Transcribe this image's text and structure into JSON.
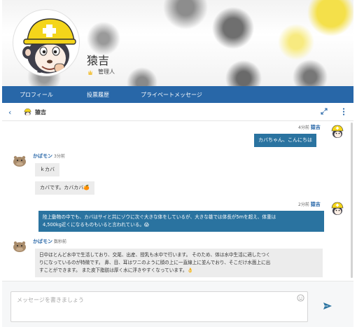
{
  "profile": {
    "name": "猿吉",
    "role": "管理人"
  },
  "nav": {
    "profile": "プロフィール",
    "votes": "投票履歴",
    "private_message": "プライベートメッセージ"
  },
  "chat_header": {
    "back": "‹",
    "title": "猿吉"
  },
  "messages": [
    {
      "time": "4分前",
      "author": "猿吉",
      "text": "カバちゃん、こんにちは"
    },
    {
      "author": "かばモン",
      "time": "3分前",
      "bubbles": [
        "ｋカバ",
        "カバです。カバカバ🍊"
      ]
    },
    {
      "time": "2分前",
      "author": "猿吉",
      "text_line1": "陸上動物の中でも、カバはサイと共にゾウに次ぐ大きな体をしているが、大きな雄では体長が5mを超え、体重は",
      "text_line2": "4,500kg近くになるものもいると言われている。😱"
    },
    {
      "author": "かばモン",
      "time": "数秒前",
      "line1": "日中ほとんど水中で生活しており、交尾、出産、授乳も水中で行います。 そのため、体は水中生活に適したつく",
      "line2": "りになっているのが特徴です。 鼻、目、耳はワニのように顔の上に一直線上に並んでおり、そこだけ水面上に出",
      "line3": "すことができます。 また皮下脂肪は厚く水に浮きやすくなっています。👌"
    }
  ],
  "composer": {
    "placeholder": "メッセージを書きましょう",
    "value": ""
  },
  "colors": {
    "brand": "#2867a8",
    "bubble_out": "#2a73a0",
    "bubble_in": "#ececec"
  },
  "icons": [
    "back-chevron",
    "expand-icon",
    "kebab-menu-icon",
    "emoji-icon",
    "send-icon",
    "crown-icon"
  ]
}
